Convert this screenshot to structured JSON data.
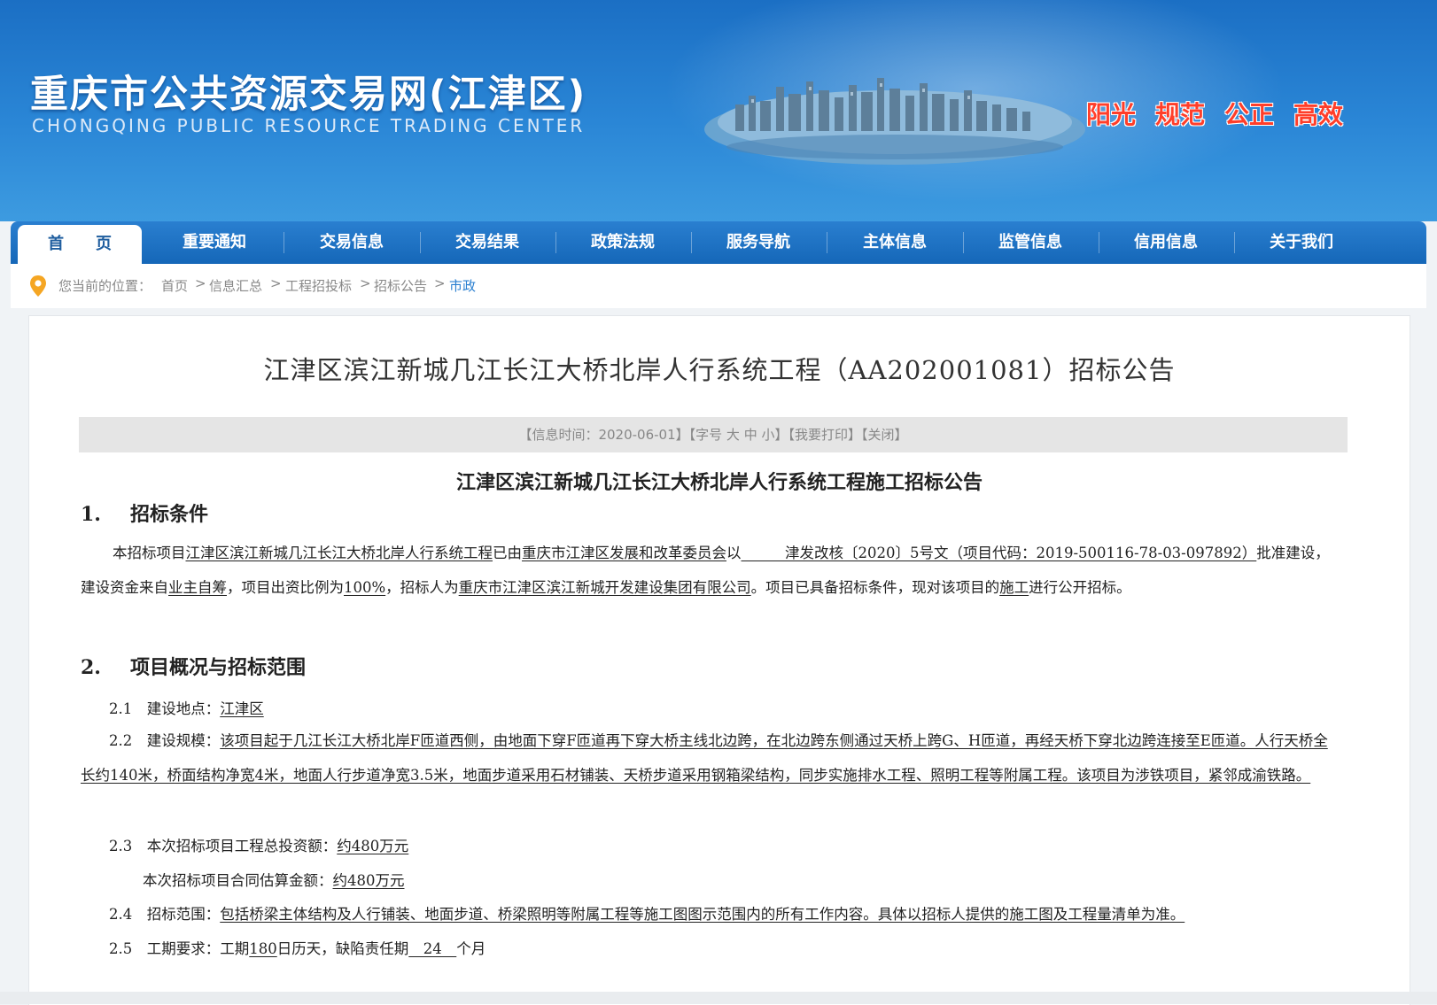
{
  "header": {
    "site_title": "重庆市公共资源交易网(江津区)",
    "site_subtitle": "CHONGQING PUBLIC RESOURCE TRADING CENTER",
    "slogans": [
      "阳光",
      "规范",
      "公正",
      "高效"
    ],
    "slogan_color": "#ff3e2a",
    "background_color": "#2a86d6"
  },
  "nav": {
    "items": [
      "首　　页",
      "重要通知",
      "交易信息",
      "交易结果",
      "政策法规",
      "服务导航",
      "主体信息",
      "监管信息",
      "信用信息",
      "关于我们"
    ],
    "active_index": 0
  },
  "breadcrumb": {
    "icon": "location-pin-icon",
    "prefix": "您当前的位置：",
    "items": [
      "首页",
      "信息汇总",
      "工程招投标",
      "招标公告",
      "市政"
    ],
    "separator": ">"
  },
  "article": {
    "title": "江津区滨江新城几江长江大桥北岸人行系统工程（AA202001081）招标公告",
    "info": {
      "time": "【信息时间：2020-06-01】",
      "font_prefix": "【字号",
      "font_large": "大",
      "font_medium": "中",
      "font_small": "小】",
      "print": "【我要打印】",
      "close": "【关闭】"
    },
    "doc_title": "江津区滨江新城几江长江大桥北岸人行系统工程施工招标公告",
    "section1": {
      "num": "1.",
      "title": "招标条件",
      "p1_a": "本招标项目",
      "p1_project": "江津区滨江新城几江长江大桥北岸人行系统工程",
      "p1_b": "已由",
      "p1_approver": "重庆市江津区发展和改革委员会",
      "p1_c": "以",
      "p1_doc": "　　　津发改核〔2020〕5号文（项目代码：2019-500116-78-03-097892）",
      "p1_d": "批准建设，建设资金来自",
      "p1_fund": "业主自筹",
      "p1_e": "，项目出资比例为",
      "p1_ratio": "100%",
      "p1_f": "，招标人为",
      "p1_tenderer": "重庆市江津区滨江新城开发建设集团有限公司",
      "p1_g": "。项目已具备招标条件，现对该项目的",
      "p1_scope": "施工",
      "p1_h": "进行公开招标。"
    },
    "section2": {
      "num": "2.",
      "title": "项目概况与招标范围",
      "l21_label": "2.1　建设地点：",
      "l21_value": "江津区",
      "l22_label": "2.2　建设规模：",
      "l22_value": "该项目起于几江长江大桥北岸F匝道西侧，由地面下穿F匝道再下穿大桥主线北边跨，在北边跨东侧通过天桥上跨G、H匝道，再经天桥下穿北边跨连接至E匝道。人行天桥全长约140米，桥面结构净宽4米，地面人行步道净宽3.5米，地面步道采用石材铺装、天桥步道采用钢箱梁结构，同步实施排水工程、照明工程等附属工程。该项目为涉铁项目，紧邻成渝铁路。",
      "l23_label": "2.3　本次招标项目工程总投资额：",
      "l23_value": "约480万元",
      "l23b_label": "本次招标项目合同估算金额：",
      "l23b_value": "约480万元",
      "l24_label": "2.4　招标范围：",
      "l24_value": "包括桥梁主体结构及人行铺装、地面步道、桥梁照明等附属工程等施工图图示范围内的所有工作内容。具体以招标人提供的施工图及工程量清单为准。",
      "l25_label": "2.5　工期要求：工期",
      "l25_days": "180",
      "l25_mid": "日历天，缺陷责任期",
      "l25_months": "　24　",
      "l25_end": "个月"
    }
  }
}
